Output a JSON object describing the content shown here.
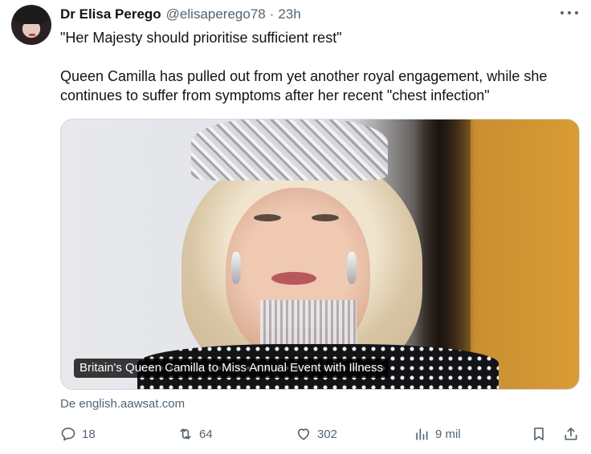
{
  "author": {
    "name": "Dr Elisa Perego",
    "handle": "@elisaperego78",
    "separator": "·",
    "time": "23h"
  },
  "tweet": {
    "quote_line": "\"Her Majesty should prioritise sufficient rest\"",
    "body": "Queen Camilla has pulled out from yet another royal engagement, while she continues to suffer from symptoms after her recent \"chest infection\""
  },
  "card": {
    "caption": "Britain's Queen Camilla to Miss Annual Event with Illness",
    "source": "De english.aawsat.com"
  },
  "actions": {
    "replies": "18",
    "reposts": "64",
    "likes": "302",
    "views": "9 mil"
  },
  "icons": {
    "more": "more-icon",
    "reply": "reply-icon",
    "repost": "repost-icon",
    "like": "heart-icon",
    "views": "views-icon",
    "bookmark": "bookmark-icon",
    "share": "share-icon"
  },
  "colors": {
    "text": "#0f1419",
    "secondary": "#536471",
    "border": "#cfd9de"
  }
}
